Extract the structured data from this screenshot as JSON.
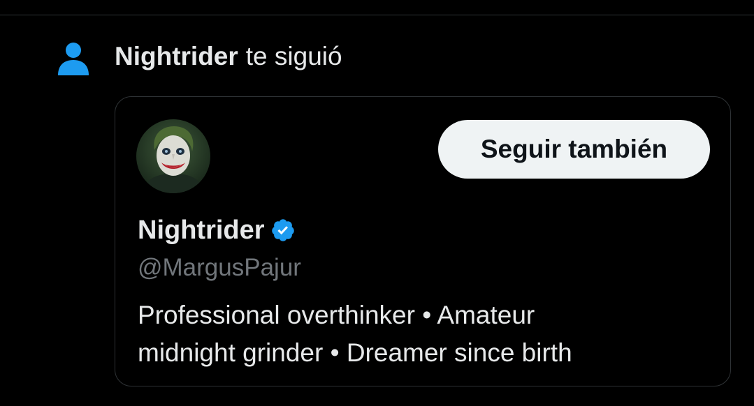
{
  "notification": {
    "actor": "Nightrider",
    "action": "te siguió",
    "icon": "person-icon",
    "icon_color": "#1d9bf0"
  },
  "card": {
    "avatar": "joker-avatar",
    "follow_button_label": "Seguir también",
    "display_name": "Nightrider",
    "verified": true,
    "verified_color": "#1d9bf0",
    "handle": "@MargusPajur",
    "bio_lines": [
      "Professional overthinker • Amateur",
      "midnight grinder • Dreamer since birth"
    ]
  },
  "colors": {
    "background": "#000000",
    "text_primary": "#e7e9ea",
    "text_secondary": "#71767b",
    "border": "#2f3336",
    "button_bg": "#eff3f4",
    "button_text": "#0f1419"
  }
}
